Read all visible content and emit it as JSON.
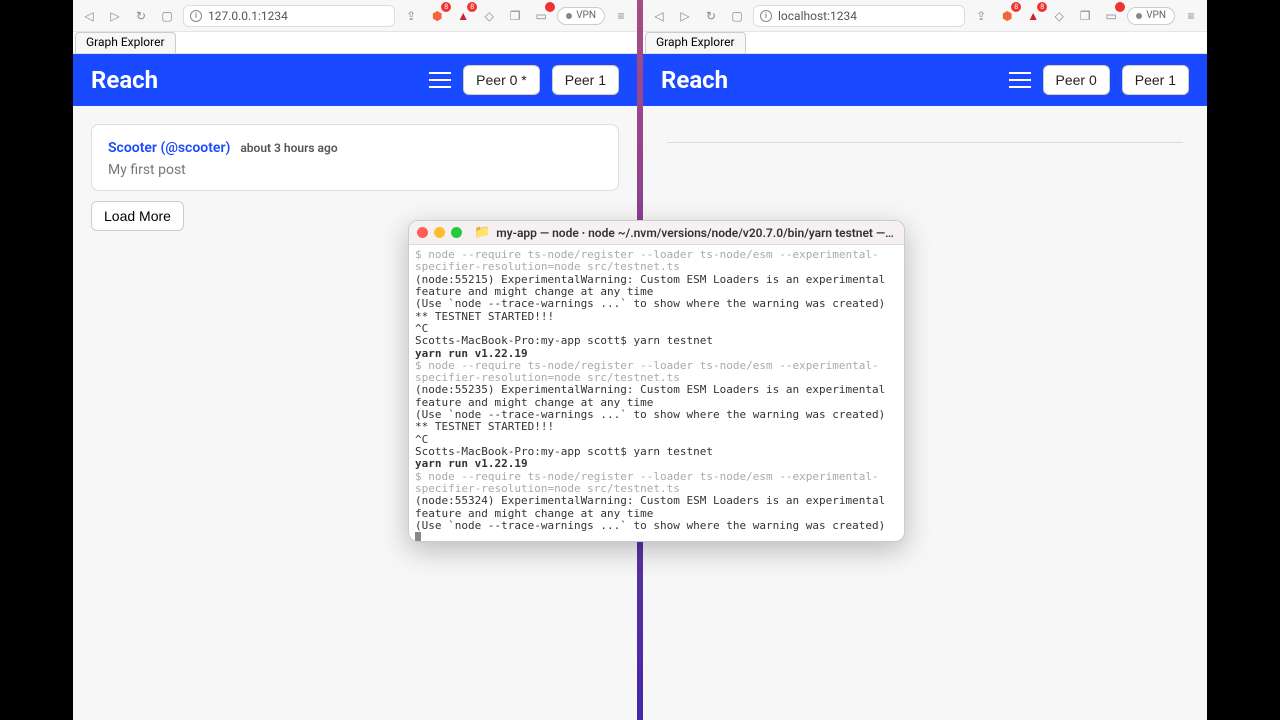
{
  "left": {
    "url": "127.0.0.1:1234",
    "tab": "Graph Explorer",
    "brand": "Reach",
    "peer0": "Peer 0 *",
    "peer1": "Peer 1",
    "post": {
      "author": "Scooter (@scooter)",
      "time": "about 3 hours ago",
      "body": "My first post"
    },
    "loadmore": "Load More",
    "shield_badge": "8"
  },
  "right": {
    "url": "localhost:1234",
    "tab": "Graph Explorer",
    "brand": "Reach",
    "peer0": "Peer 0",
    "peer1": "Peer 1",
    "shield_badge": "8"
  },
  "vpn_label": "VPN",
  "terminal": {
    "title": "my-app — node ∙ node ~/.nvm/versions/node/v20.7.0/bin/yarn testnet — 8...",
    "lines": [
      {
        "cls": "g",
        "t": "$ node --require ts-node/register --loader ts-node/esm --experimental-specifier-resolution=node src/testnet.ts"
      },
      {
        "cls": "",
        "t": "(node:55215) ExperimentalWarning: Custom ESM Loaders is an experimental feature and might change at any time"
      },
      {
        "cls": "",
        "t": "(Use `node --trace-warnings ...` to show where the warning was created)"
      },
      {
        "cls": "",
        "t": "** TESTNET STARTED!!!"
      },
      {
        "cls": "",
        "t": "^C"
      },
      {
        "cls": "",
        "t": "Scotts-MacBook-Pro:my-app scott$ yarn testnet"
      },
      {
        "cls": "b",
        "t": "yarn run v1.22.19"
      },
      {
        "cls": "g",
        "t": "$ node --require ts-node/register --loader ts-node/esm --experimental-specifier-resolution=node src/testnet.ts"
      },
      {
        "cls": "",
        "t": "(node:55235) ExperimentalWarning: Custom ESM Loaders is an experimental feature and might change at any time"
      },
      {
        "cls": "",
        "t": "(Use `node --trace-warnings ...` to show where the warning was created)"
      },
      {
        "cls": "",
        "t": "** TESTNET STARTED!!!"
      },
      {
        "cls": "",
        "t": "^C"
      },
      {
        "cls": "",
        "t": "Scotts-MacBook-Pro:my-app scott$ yarn testnet"
      },
      {
        "cls": "b",
        "t": "yarn run v1.22.19"
      },
      {
        "cls": "g",
        "t": "$ node --require ts-node/register --loader ts-node/esm --experimental-specifier-resolution=node src/testnet.ts"
      },
      {
        "cls": "",
        "t": "(node:55324) ExperimentalWarning: Custom ESM Loaders is an experimental feature and might change at any time"
      },
      {
        "cls": "",
        "t": "(Use `node --trace-warnings ...` to show where the warning was created)"
      }
    ]
  }
}
